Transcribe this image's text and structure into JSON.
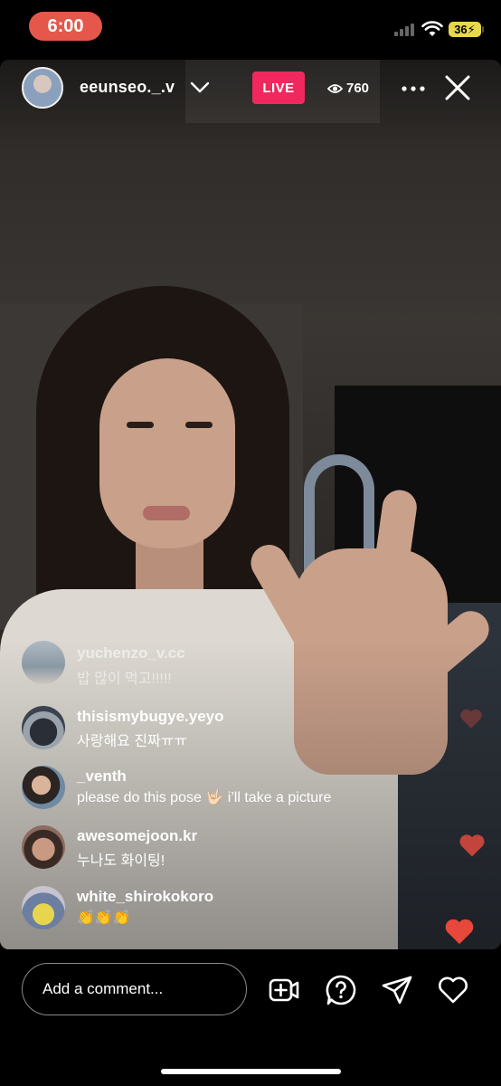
{
  "status_bar": {
    "time": "6:00",
    "battery": "36",
    "time_pill_color": "#e5574b",
    "battery_color": "#e8d84c"
  },
  "header": {
    "username": "eeunseo._.v",
    "live_label": "LIVE",
    "live_color": "#f0285d",
    "viewer_count": "760",
    "icons": [
      "chevron-down-icon",
      "eye-icon",
      "more-icon",
      "close-icon"
    ]
  },
  "comments": [
    {
      "username": "yuchenzo_v.cc",
      "text": "밥 많이 먹고!!!!!",
      "faded": true
    },
    {
      "username": "thisismybugye.yeyo",
      "text": "사랑해요 진짜ㅠㅠ"
    },
    {
      "username": "_venth",
      "text": "please do this pose 🤟🏻 i’ll take a picture"
    },
    {
      "username": "awesomejoon.kr",
      "text": "누나도 화이팅!"
    },
    {
      "username": "white_shirokokoro",
      "text": "👏👏👏"
    }
  ],
  "bottom_bar": {
    "comment_placeholder": "Add a comment...",
    "icons": [
      "add-video-icon",
      "question-icon",
      "share-icon",
      "heart-icon"
    ]
  }
}
